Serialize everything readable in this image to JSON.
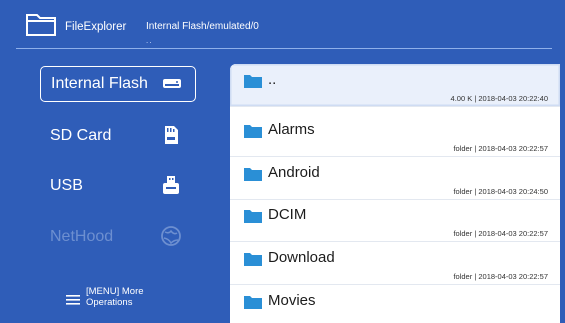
{
  "header": {
    "app_title": "FileExplorer",
    "path": "Internal Flash/emulated/0",
    "path_marker": ".."
  },
  "sidebar": {
    "items": [
      {
        "label": "Internal Flash",
        "icon": "hard-drive-icon",
        "active": true,
        "enabled": true
      },
      {
        "label": "SD Card",
        "icon": "sd-card-icon",
        "active": false,
        "enabled": true
      },
      {
        "label": "USB",
        "icon": "usb-icon",
        "active": false,
        "enabled": true
      },
      {
        "label": "NetHood",
        "icon": "network-globe-icon",
        "active": false,
        "enabled": false
      }
    ]
  },
  "more_operations": {
    "line1": "[MENU] More",
    "line2": "Operations",
    "icon": "menu-icon"
  },
  "files": [
    {
      "name": "..",
      "meta": "4.00 K | 2018-04-03 20:22:40",
      "selected": true
    },
    {
      "name": "Alarms",
      "meta": "folder | 2018-04-03 20:22:57",
      "selected": false
    },
    {
      "name": "Android",
      "meta": "folder | 2018-04-03 20:24:50",
      "selected": false
    },
    {
      "name": "DCIM",
      "meta": "folder | 2018-04-03 20:22:57",
      "selected": false
    },
    {
      "name": "Download",
      "meta": "folder | 2018-04-03 20:22:57",
      "selected": false
    },
    {
      "name": "Movies",
      "meta": "",
      "selected": false
    }
  ],
  "colors": {
    "background": "#2f5db8",
    "panel": "#ffffff",
    "folder": "#2a8fd6",
    "disabled_text": "#6d8fd0"
  }
}
